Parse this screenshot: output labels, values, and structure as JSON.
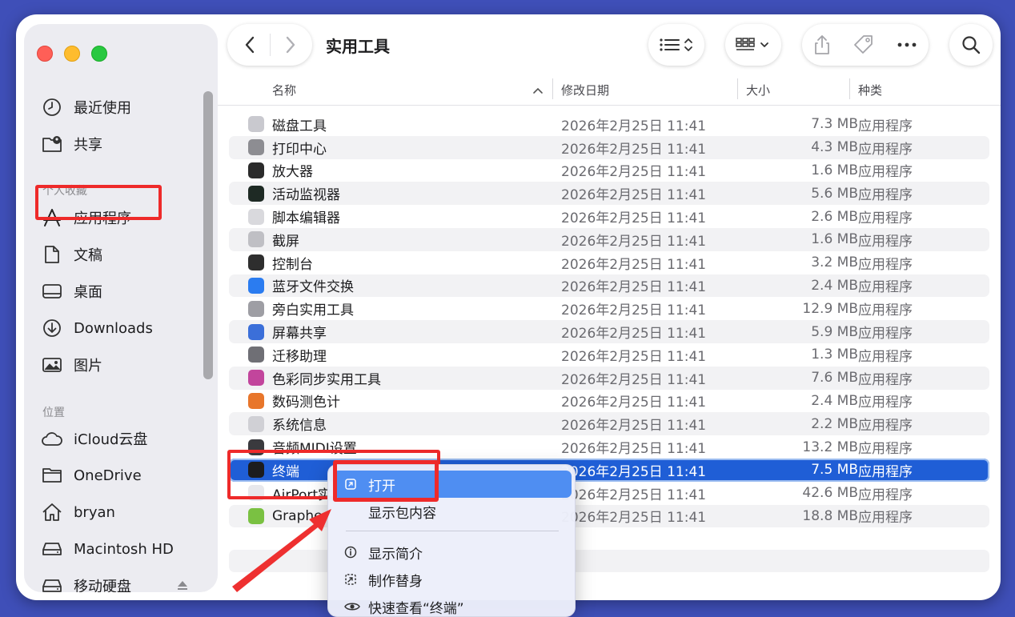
{
  "window": {
    "title": "实用工具"
  },
  "sidebar": {
    "top_items": [
      {
        "label": "最近使用",
        "icon": "clock-icon"
      },
      {
        "label": "共享",
        "icon": "shared-folder-icon"
      }
    ],
    "favorites_heading": "个人收藏",
    "favorites": [
      {
        "label": "应用程序",
        "icon": "applications-icon"
      },
      {
        "label": "文稿",
        "icon": "document-icon"
      },
      {
        "label": "桌面",
        "icon": "desktop-icon"
      },
      {
        "label": "Downloads",
        "icon": "download-icon"
      },
      {
        "label": "图片",
        "icon": "photo-icon"
      }
    ],
    "locations_heading": "位置",
    "locations": [
      {
        "label": "iCloud云盘",
        "icon": "cloud-icon"
      },
      {
        "label": "OneDrive",
        "icon": "folder-icon"
      },
      {
        "label": "bryan",
        "icon": "home-icon"
      },
      {
        "label": "Macintosh HD",
        "icon": "disk-icon"
      },
      {
        "label": "移动硬盘",
        "icon": "disk-icon"
      }
    ]
  },
  "columns": {
    "name": "名称",
    "date": "修改日期",
    "size": "大小",
    "kind": "种类"
  },
  "files": [
    {
      "name": "磁盘工具",
      "date": "2026年2月25日 11:41",
      "size": "7.3 MB",
      "kind": "应用程序",
      "color": "#c9c9cf"
    },
    {
      "name": "打印中心",
      "date": "2026年2月25日 11:41",
      "size": "4.3 MB",
      "kind": "应用程序",
      "color": "#8d8d92"
    },
    {
      "name": "放大器",
      "date": "2026年2月25日 11:41",
      "size": "1.6 MB",
      "kind": "应用程序",
      "color": "#2b2b2b"
    },
    {
      "name": "活动监视器",
      "date": "2026年2月25日 11:41",
      "size": "5.6 MB",
      "kind": "应用程序",
      "color": "#1e2a24"
    },
    {
      "name": "脚本编辑器",
      "date": "2026年2月25日 11:41",
      "size": "2.6 MB",
      "kind": "应用程序",
      "color": "#d9d9dd"
    },
    {
      "name": "截屏",
      "date": "2026年2月25日 11:41",
      "size": "1.6 MB",
      "kind": "应用程序",
      "color": "#bfbfc4"
    },
    {
      "name": "控制台",
      "date": "2026年2月25日 11:41",
      "size": "3.2 MB",
      "kind": "应用程序",
      "color": "#2e2e2e"
    },
    {
      "name": "蓝牙文件交换",
      "date": "2026年2月25日 11:41",
      "size": "2.4 MB",
      "kind": "应用程序",
      "color": "#2b7cf0"
    },
    {
      "name": "旁白实用工具",
      "date": "2026年2月25日 11:41",
      "size": "12.9 MB",
      "kind": "应用程序",
      "color": "#9e9ea4"
    },
    {
      "name": "屏幕共享",
      "date": "2026年2月25日 11:41",
      "size": "5.9 MB",
      "kind": "应用程序",
      "color": "#3b6fd9"
    },
    {
      "name": "迁移助理",
      "date": "2026年2月25日 11:41",
      "size": "1.3 MB",
      "kind": "应用程序",
      "color": "#6f6f75"
    },
    {
      "name": "色彩同步实用工具",
      "date": "2026年2月25日 11:41",
      "size": "7.6 MB",
      "kind": "应用程序",
      "color": "#c2459c"
    },
    {
      "name": "数码测色计",
      "date": "2026年2月25日 11:41",
      "size": "2.4 MB",
      "kind": "应用程序",
      "color": "#e8762b"
    },
    {
      "name": "系统信息",
      "date": "2026年2月25日 11:41",
      "size": "2.2 MB",
      "kind": "应用程序",
      "color": "#d0d0d5"
    },
    {
      "name": "音频MIDI设置",
      "date": "2026年2月25日 11:41",
      "size": "13.2 MB",
      "kind": "应用程序",
      "color": "#3a3a3e"
    },
    {
      "name": "终端",
      "date": "2026年2月25日 11:41",
      "size": "7.5 MB",
      "kind": "应用程序",
      "color": "#1c1c1e"
    },
    {
      "name": "AirPort实用工具",
      "date": "2026年2月25日 11:41",
      "size": "42.6 MB",
      "kind": "应用程序",
      "color": "#e8e8ec"
    },
    {
      "name": "Grapher",
      "date": "2026年2月25日 11:41",
      "size": "18.8 MB",
      "kind": "应用程序",
      "color": "#7ac142"
    }
  ],
  "selected_file": "终端",
  "context_menu": {
    "items": [
      {
        "label": "打开",
        "icon": "open-icon"
      },
      {
        "label": "显示包内容",
        "icon": ""
      },
      {
        "label": "显示简介",
        "icon": "info-icon"
      },
      {
        "label": "制作替身",
        "icon": "alias-icon"
      },
      {
        "label": "快速查看“终端”",
        "icon": "eye-icon"
      }
    ]
  },
  "colors": {
    "accent": "#1f5ed6",
    "menu_highlight": "#4f8ef2",
    "annotation_red": "#ee2a2a",
    "background": "#3f4fb8"
  }
}
